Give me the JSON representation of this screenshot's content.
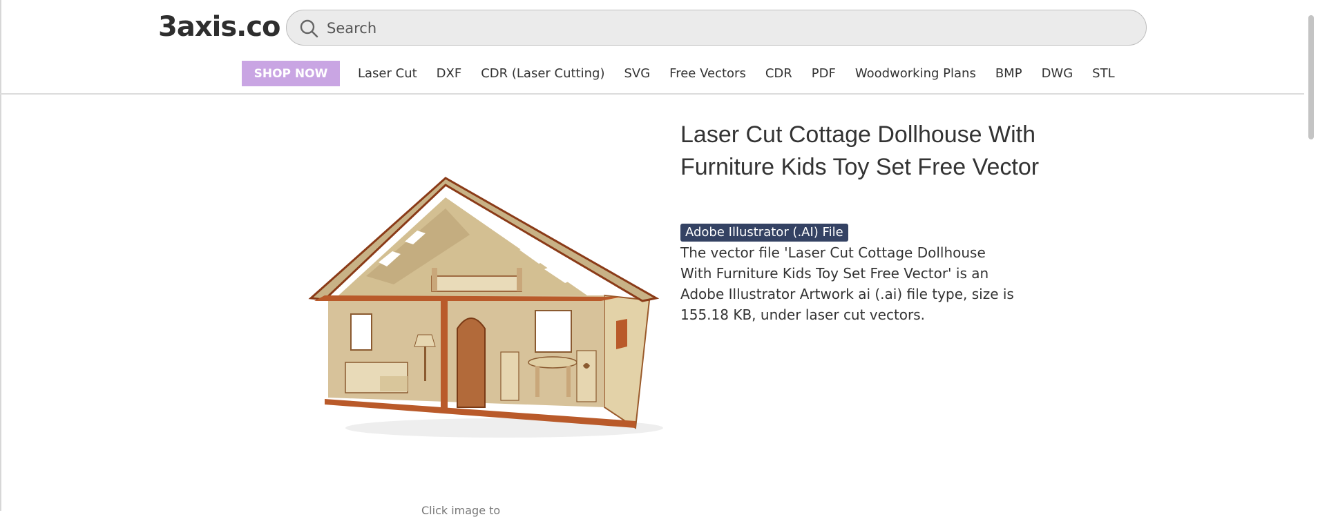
{
  "header": {
    "logo": "3axis.co",
    "search": {
      "placeholder": "Search",
      "value": ""
    }
  },
  "nav": {
    "shop_now": "SHOP NOW",
    "links": [
      "Laser Cut",
      "DXF",
      "CDR (Laser Cutting)",
      "SVG",
      "Free Vectors",
      "CDR",
      "PDF",
      "Woodworking Plans",
      "BMP",
      "DWG",
      "STL"
    ]
  },
  "product": {
    "title": "Laser Cut Cottage Dollhouse With Furniture Kids Toy Set Free Vector",
    "file_type_badge": "Adobe Illustrator (.AI) File",
    "description": "The vector file 'Laser Cut Cottage Dollhouse With Furniture Kids Toy Set Free Vector' is an Adobe Illustrator Artwork ai (.ai) file type, size is 155.18 KB, under laser cut vectors.",
    "caption": "Click image to"
  },
  "colors": {
    "shop_now_bg": "#c9a5e3",
    "badge_bg": "#344263",
    "search_bg": "#ebebeb"
  }
}
